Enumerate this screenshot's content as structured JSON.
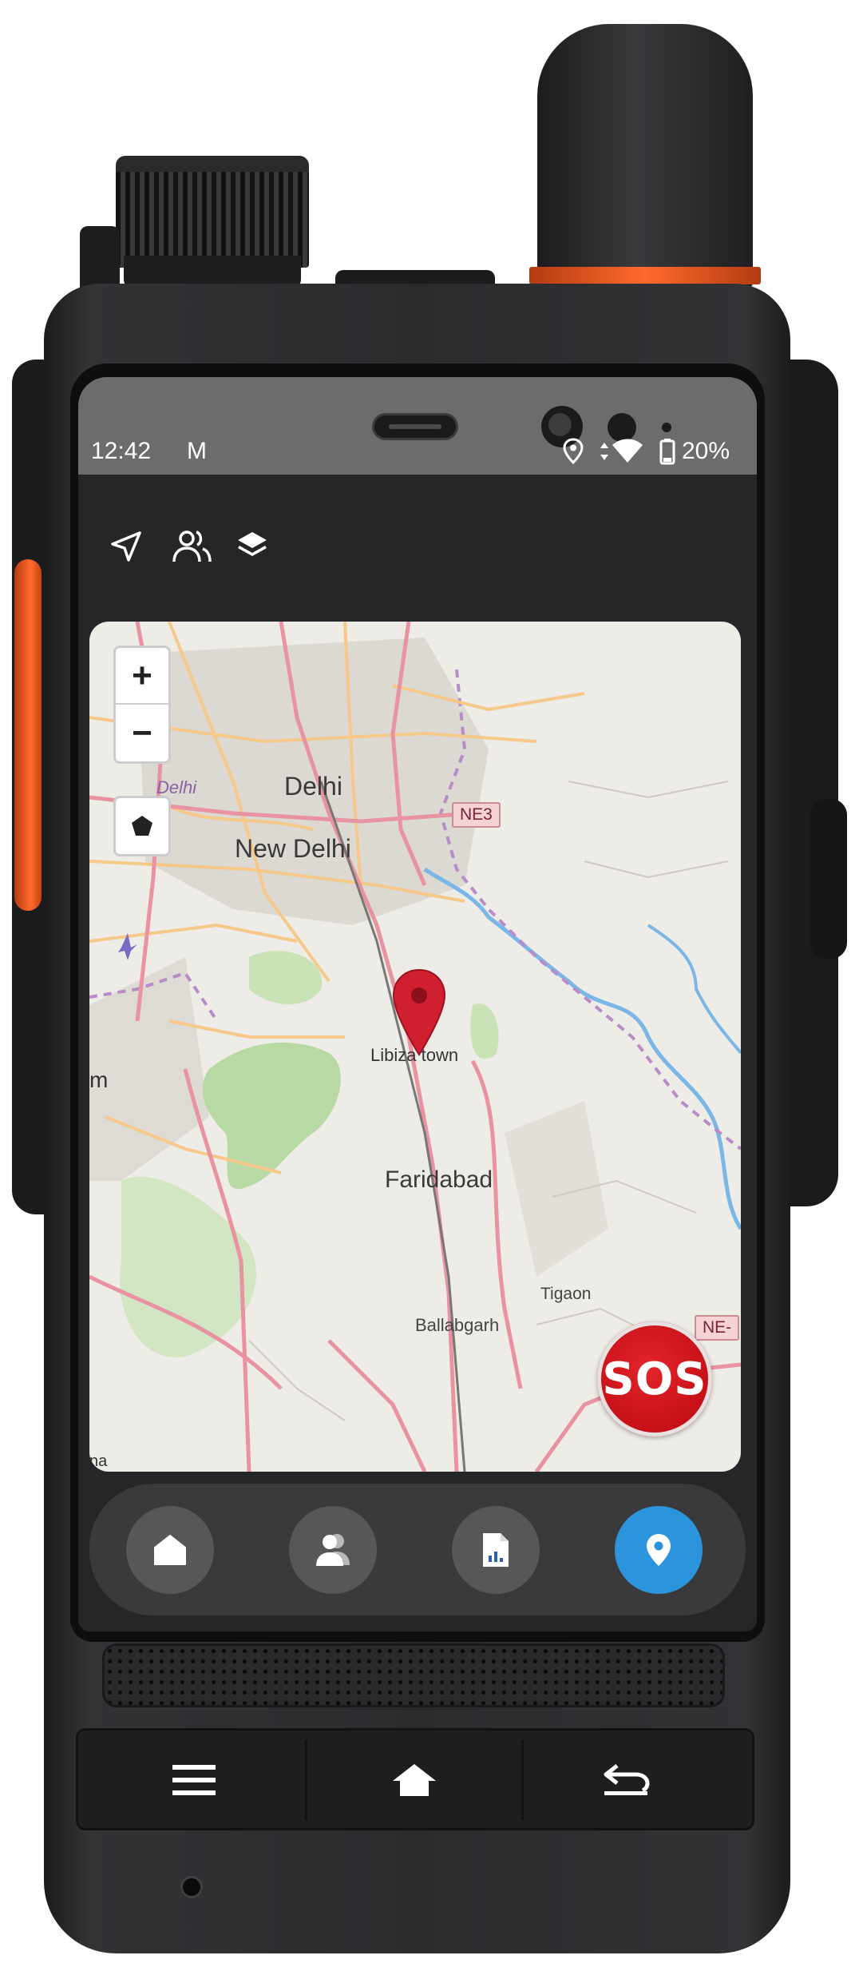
{
  "status_bar": {
    "time": "12:42",
    "indicator": "M",
    "battery_percent": "20%",
    "icons": [
      "location-icon",
      "data-arrows-icon",
      "wifi-icon",
      "battery-icon"
    ]
  },
  "toolbar": {
    "icons": [
      "navigate-icon",
      "group-icon",
      "layers-icon"
    ]
  },
  "map": {
    "zoom_in_label": "+",
    "zoom_out_label": "−",
    "labels": {
      "delhi_west": "Delhi",
      "delhi": "Delhi",
      "new_delhi": "New Delhi",
      "marker_place": "Libiza town",
      "faridabad": "Faridabad",
      "tigaon": "Tigaon",
      "ballabgarh": "Ballabgarh",
      "edge_m": "m",
      "edge_na": "na"
    },
    "shields": {
      "ne3": "NE3",
      "ne_east": "NE-"
    },
    "sos_label": "SOS",
    "colors": {
      "land": "#eeece6",
      "road_major": "#e892a2",
      "road_secondary": "#f6c88a",
      "park": "#cde3c0",
      "water": "#7ab6e6",
      "marker": "#d0202f"
    }
  },
  "bottom_nav": {
    "items": [
      {
        "name": "home",
        "icon": "home-icon",
        "active": false
      },
      {
        "name": "contacts",
        "icon": "contacts-icon",
        "active": false
      },
      {
        "name": "reports",
        "icon": "report-icon",
        "active": false
      },
      {
        "name": "location",
        "icon": "location-pin-icon",
        "active": true
      }
    ],
    "active_color": "#2b94dc"
  },
  "hardware_keys": {
    "icons": [
      "menu-icon",
      "home-icon",
      "back-icon"
    ]
  }
}
